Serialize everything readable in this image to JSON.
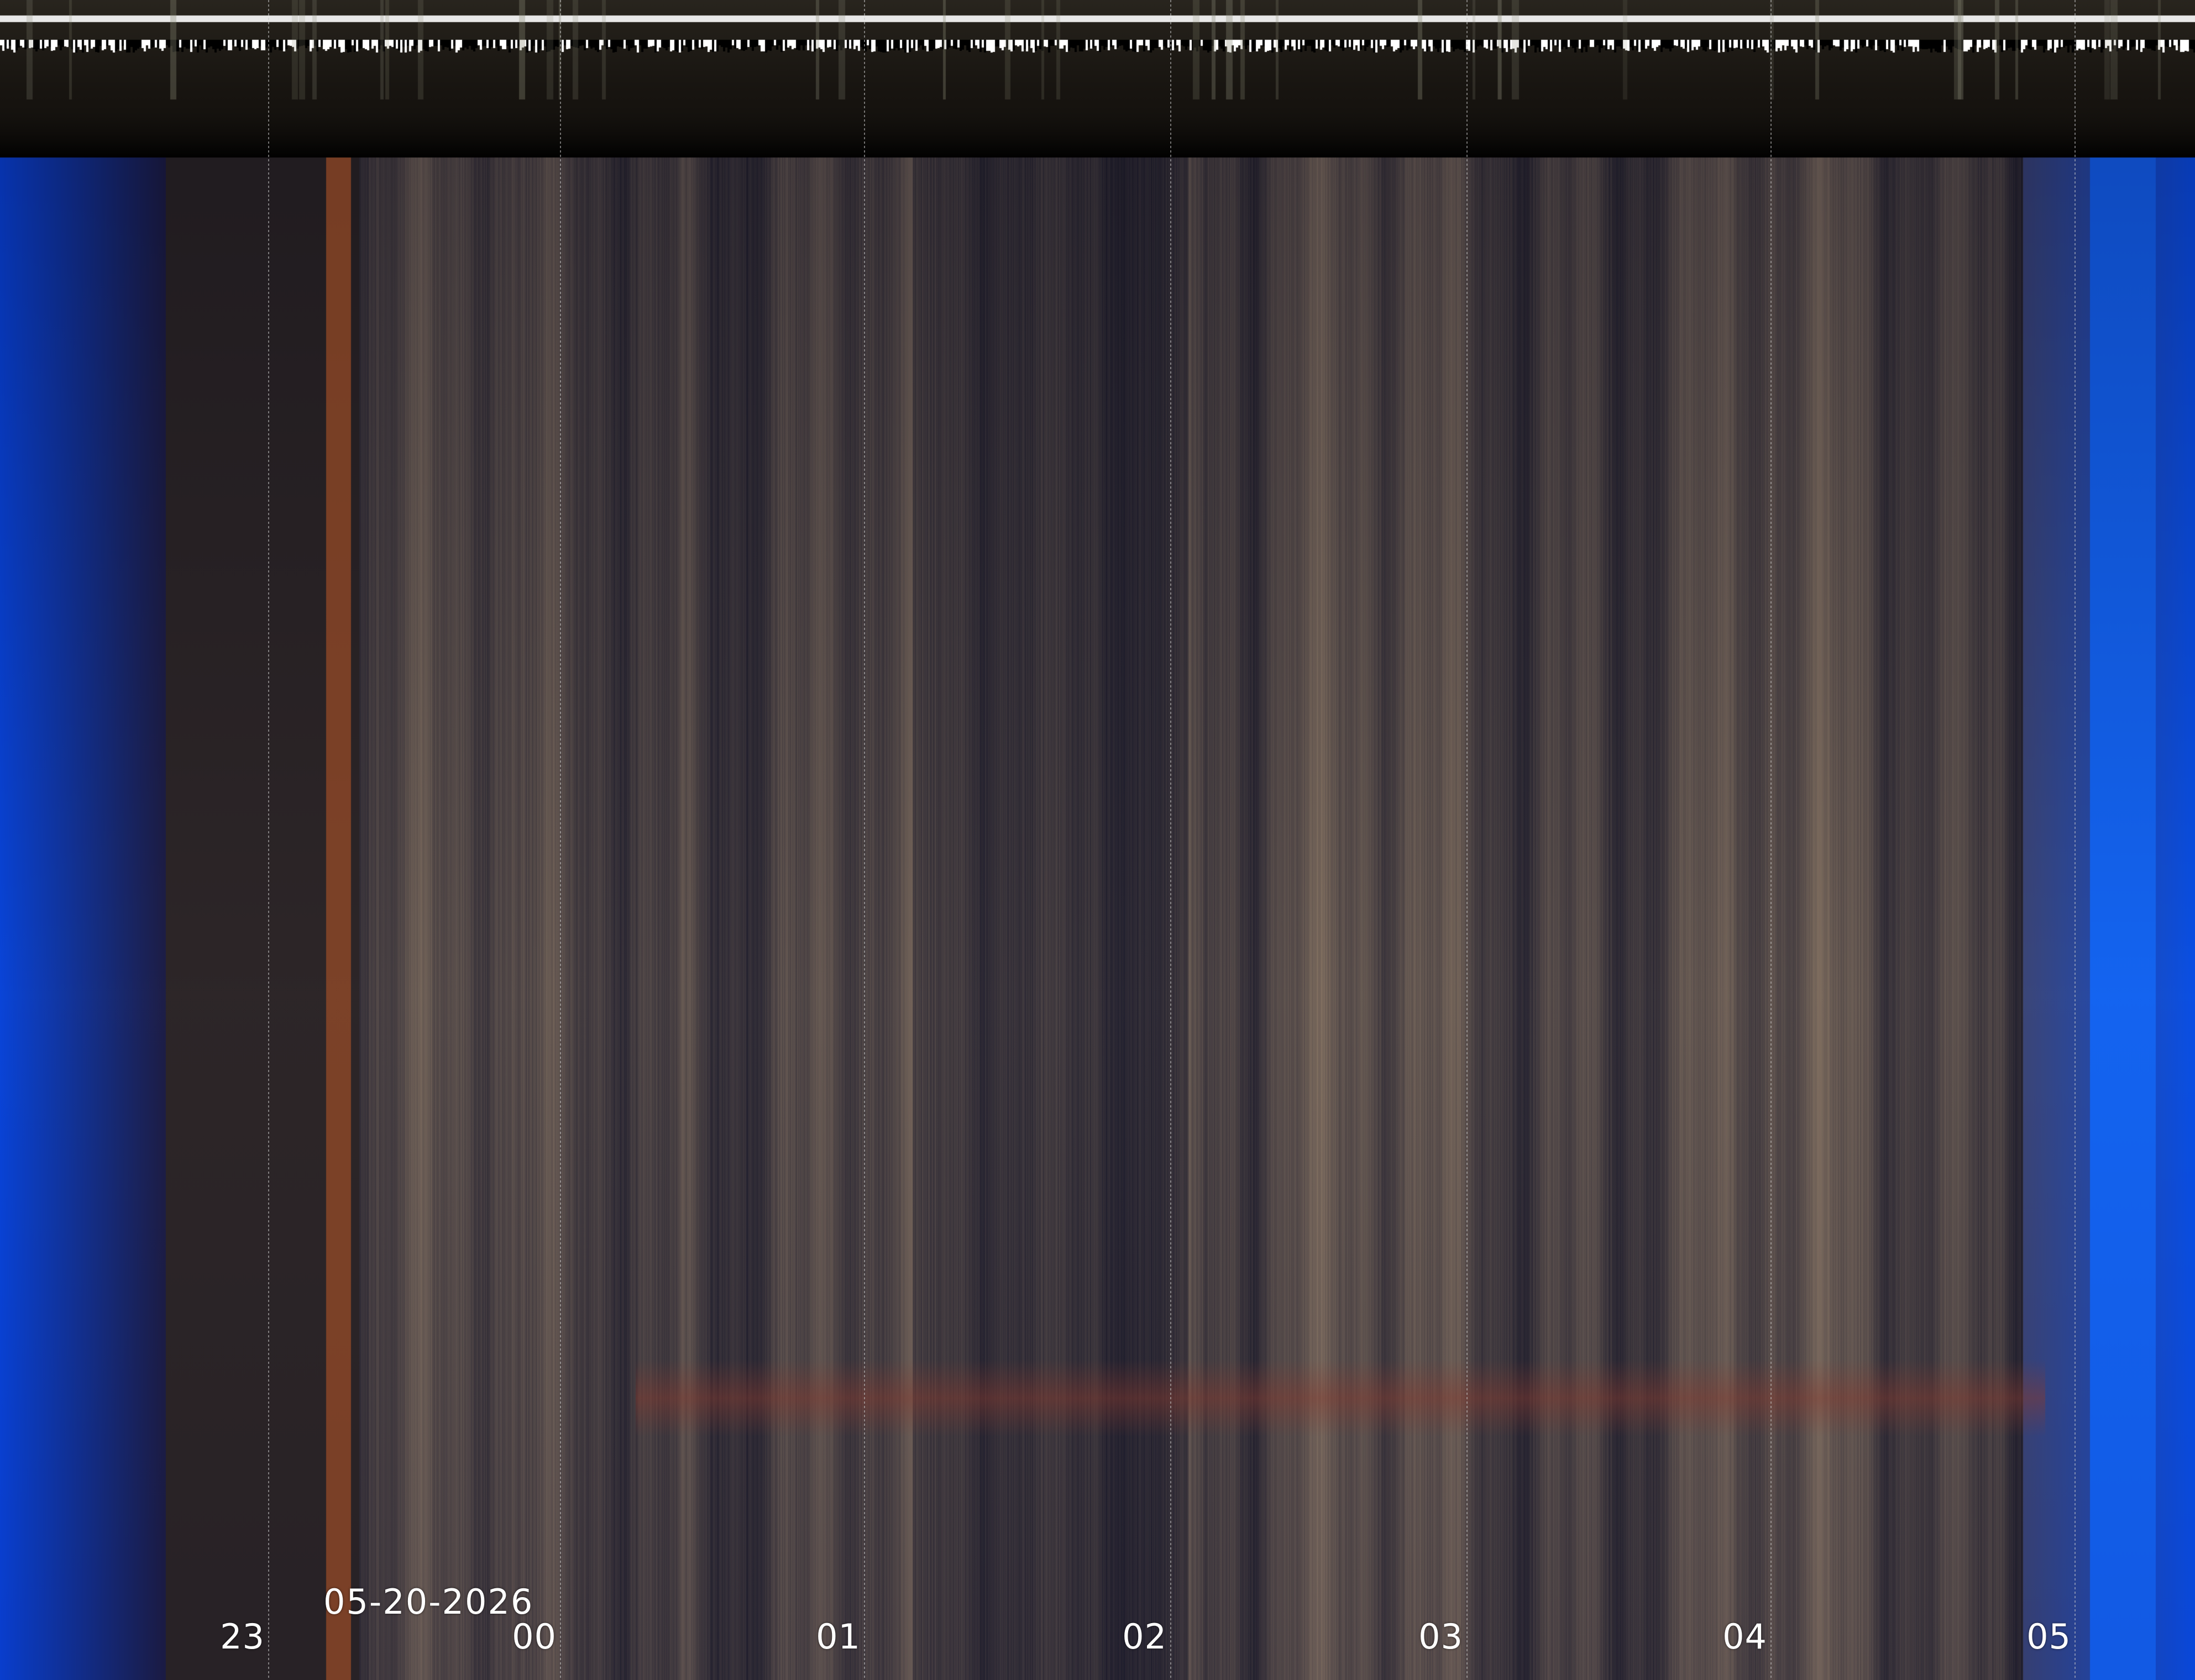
{
  "keogram": {
    "date_label": "05-20-2026",
    "hour_ticks": [
      "23",
      "00",
      "01",
      "02",
      "03",
      "04",
      "05"
    ],
    "colors": {
      "twilight_blue": "#0a45d8",
      "night_dark": "#242230",
      "sky_tan": "#8a7765",
      "horizon_glow": "#8a3a2e",
      "header_band": "#0c0a08",
      "label_text": "#ffffff"
    }
  }
}
